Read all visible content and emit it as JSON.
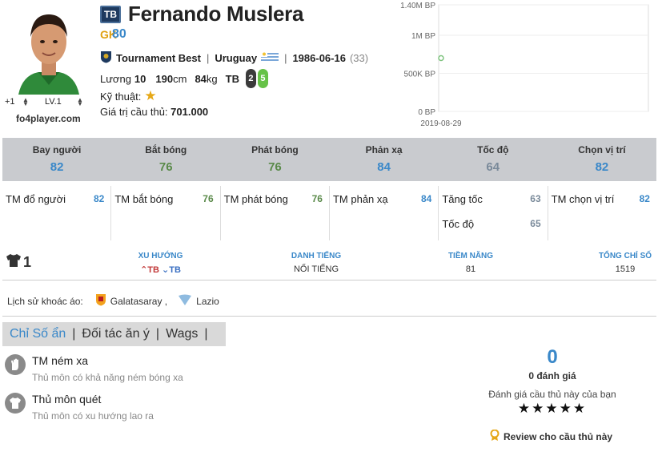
{
  "player": {
    "season_badge": "TB",
    "name": "Fernando Muslera",
    "position": "GK",
    "ovr": "80",
    "team": "Tournament Best",
    "nation": "Uruguay",
    "dob": "1986-06-16",
    "age": "(33)",
    "salary_label": "Lương",
    "salary": "10",
    "height": "190",
    "height_unit": "cm",
    "weight": "84",
    "weight_unit": "kg",
    "build": "TB",
    "left_foot": "2",
    "right_foot": "5",
    "skill_label": "Kỹ thuật:",
    "skill_stars": "★",
    "value_label": "Giá trị cầu thủ:",
    "value": "701.000",
    "level_plus": "+1",
    "level": "LV.1",
    "site": "fo4player.com"
  },
  "price_chart": {
    "chart_data": {
      "type": "line",
      "x": [
        "2019-08-29"
      ],
      "series": [
        {
          "values": [
            700000
          ]
        }
      ],
      "yticks": [
        "1.40M BP",
        "1M BP",
        "500K BP",
        "0 BP"
      ],
      "ylim": [
        0,
        1400000
      ],
      "grid": true
    }
  },
  "stats": [
    {
      "label": "Bay người",
      "value": "82",
      "color": "#3a88c9"
    },
    {
      "label": "Bắt bóng",
      "value": "76",
      "color": "#5a8a4a"
    },
    {
      "label": "Phát bóng",
      "value": "76",
      "color": "#5a8a4a"
    },
    {
      "label": "Phản xạ",
      "value": "84",
      "color": "#3a88c9"
    },
    {
      "label": "Tốc độ",
      "value": "64",
      "color": "#7a8a9a"
    },
    {
      "label": "Chọn vị trí",
      "value": "82",
      "color": "#3a88c9"
    }
  ],
  "sub_stats": [
    [
      {
        "label": "TM đổ người",
        "value": "82"
      }
    ],
    [
      {
        "label": "TM bắt bóng",
        "value": "76"
      }
    ],
    [
      {
        "label": "TM phát bóng",
        "value": "76"
      }
    ],
    [
      {
        "label": "TM phản xạ",
        "value": "84"
      }
    ],
    [
      {
        "label": "Tăng tốc",
        "value": "63"
      },
      {
        "label": "Tốc độ",
        "value": "65"
      }
    ],
    [
      {
        "label": "TM chọn vị trí",
        "value": "82"
      }
    ]
  ],
  "meta": {
    "shirt_number": "1",
    "trend_header": "XU HƯỚNG",
    "trend_up": "TB",
    "trend_down": "TB",
    "fame_header": "DANH TIẾNG",
    "fame_value": "NỔI TIẾNG",
    "potential_header": "TIỀM NĂNG",
    "potential_value": "81",
    "total_header": "TỔNG CHỈ SỐ",
    "total_value": "1519"
  },
  "history": {
    "label": "Lịch sử khoác áo:",
    "club1": "Galatasaray ,",
    "club2": "Lazio"
  },
  "tabs": {
    "hidden_stats": "Chỉ Số ẩn",
    "partners": "Đối tác ăn ý",
    "wags": "Wags",
    "sep": "|"
  },
  "traits": [
    {
      "title": "TM ném xa",
      "desc": "Thủ môn có khả năng ném bóng xa"
    },
    {
      "title": "Thủ môn quét",
      "desc": "Thủ môn có xu hướng lao ra"
    }
  ],
  "rating": {
    "score": "0",
    "count_text": "0 đánh giá",
    "prompt": "Đánh giá cầu thủ này của bạn",
    "stars": "★★★★★",
    "review_label": "Review cho cầu thủ này"
  },
  "colors": {
    "accent": "#3a88c9",
    "green_stat": "#5a8a4a",
    "gray_stat": "#7a8a9a",
    "band": "#c9cbcf"
  }
}
